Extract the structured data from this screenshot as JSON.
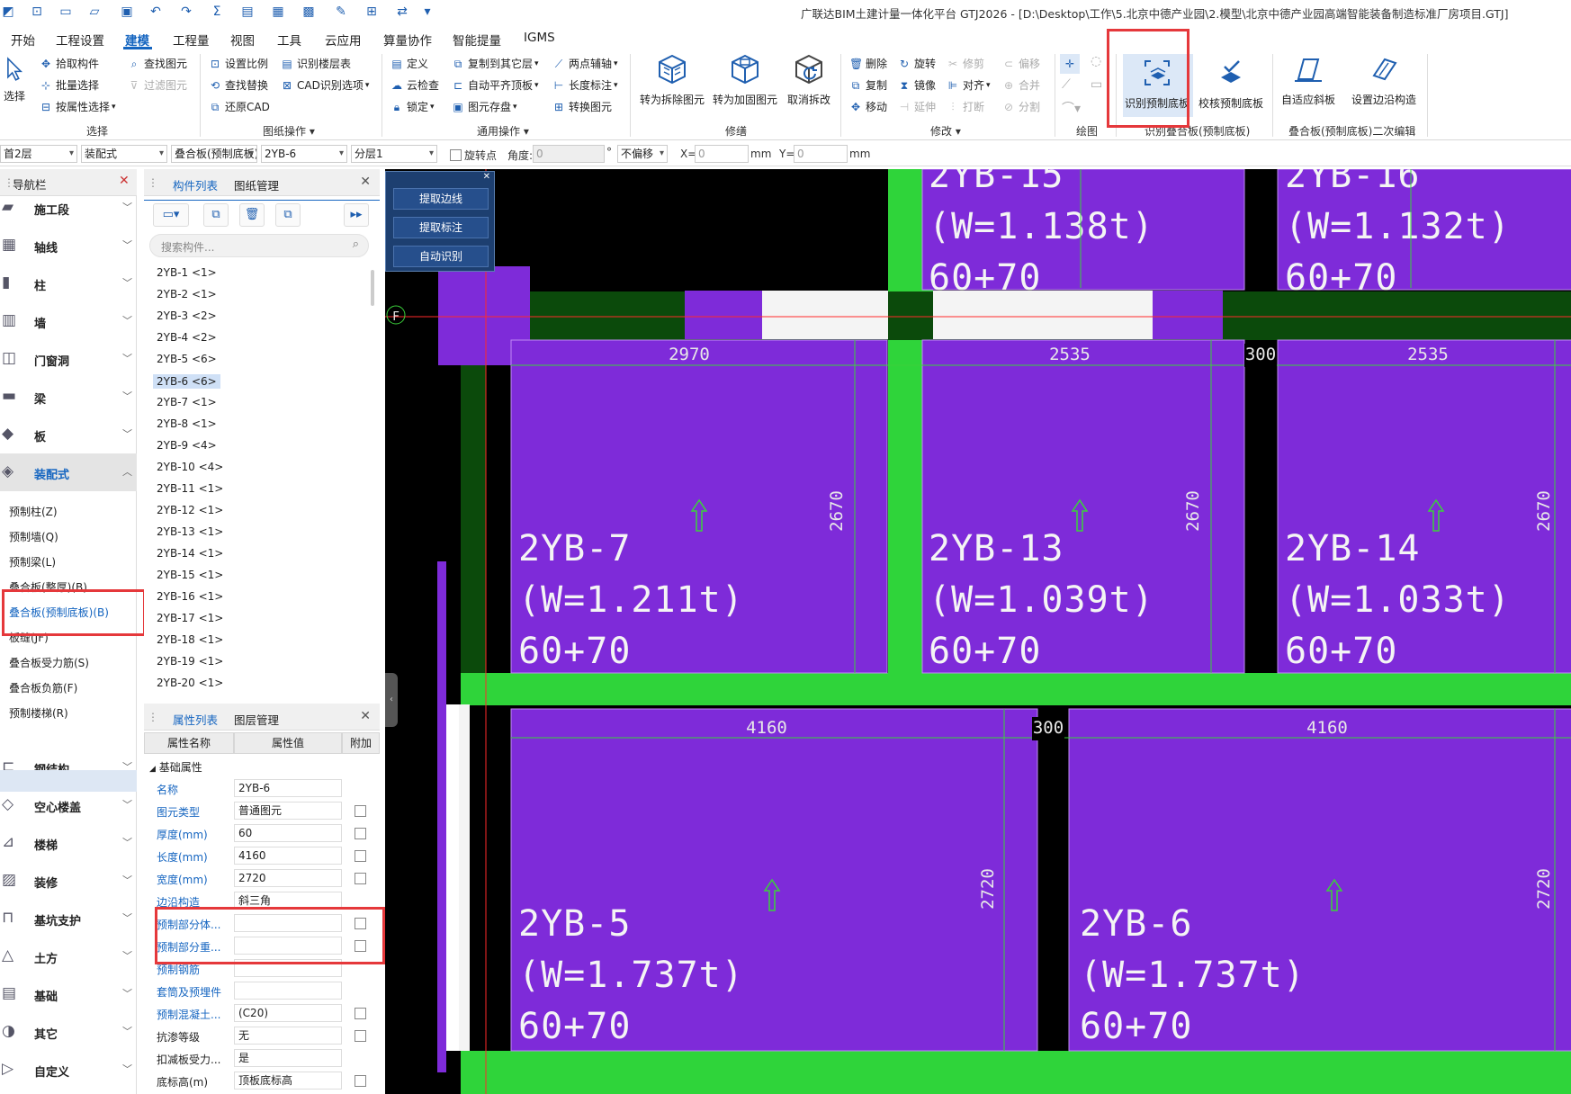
{
  "window": {
    "title": "广联达BIM土建计量一体化平台 GTJ2026 - [D:\\Desktop\\工作\\5.北京中德产业园\\2.模型\\北京中德产业园高端智能装备制造标准厂房项目.GTJ]"
  },
  "menu": {
    "tabs": [
      "开始",
      "工程设置",
      "建模",
      "工程量",
      "视图",
      "工具",
      "云应用",
      "算量协作",
      "智能提量",
      "IGMS"
    ],
    "active": "建模"
  },
  "ribbon": {
    "select_group": {
      "label": "选择",
      "select": "选择",
      "pick": "拾取构件",
      "batch": "批量选择",
      "by_attr": "按属性选择",
      "find": "查找图元",
      "filter": "过滤图元"
    },
    "drawing_group": {
      "label": "图纸操作",
      "set_scale": "设置比例",
      "find_replace": "查找替换",
      "restore_cad": "还原CAD",
      "identify_floor": "识别楼层表",
      "cad_options": "CAD识别选项"
    },
    "general_group": {
      "label": "通用操作",
      "define": "定义",
      "cloud_check": "云检查",
      "lock": "锁定",
      "copy_to_other": "复制到其它层",
      "auto_flat": "自动平齐顶板",
      "save_elem": "图元存盘",
      "two_point_aux": "两点辅轴",
      "length_dim": "长度标注",
      "convert_elem": "转换图元"
    },
    "repair_group": {
      "label": "修缮",
      "to_demolish": "转为拆除图元",
      "to_reinforce": "转为加固图元",
      "cancel_demolish": "取消拆改"
    },
    "modify_group": {
      "label": "修改",
      "delete": "删除",
      "rotate": "旋转",
      "trim": "修剪",
      "offset": "偏移",
      "copy": "复制",
      "mirror": "镜像",
      "align": "对齐",
      "merge": "合并",
      "move": "移动",
      "extend": "延伸",
      "break": "打断",
      "split": "分割"
    },
    "draw_group": {
      "label": "绘图"
    },
    "identify_group": {
      "label": "识别叠合板(预制底板)",
      "identify_bottom": "识别预制底板",
      "check_bottom": "校核预制底板"
    },
    "secondary_group": {
      "label": "叠合板(预制底板)二次编辑",
      "adaptive_slope": "自适应斜板",
      "set_edge": "设置边沿构造"
    }
  },
  "option_bar": {
    "floor": "首2层",
    "category": "装配式",
    "type": "叠合板(预制底板)",
    "component": "2YB-6",
    "sublayer": "分层1",
    "rotate_point": "旋转点",
    "angle_label": "角度:",
    "angle_value": "0",
    "degree": "°",
    "offset_mode": "不偏移",
    "x_label": "X=",
    "x_value": "0",
    "y_label": "Y=",
    "y_value": "0",
    "unit": "mm"
  },
  "nav": {
    "title": "导航栏",
    "categories": [
      "施工段",
      "轴线",
      "柱",
      "墙",
      "门窗洞",
      "梁",
      "板",
      "装配式",
      "钢结构",
      "空心楼盖",
      "楼梯",
      "装修",
      "基坑支护",
      "土方",
      "基础",
      "其它",
      "自定义"
    ],
    "expanded": "装配式",
    "sub_items": [
      "预制柱(Z)",
      "预制墙(Q)",
      "预制梁(L)",
      "叠合板(整厚)(B)",
      "叠合板(预制底板)(B)",
      "板缝(JF)",
      "叠合板受力筋(S)",
      "叠合板负筋(F)",
      "预制楼梯(R)"
    ],
    "active_sub": "叠合板(预制底板)(B)"
  },
  "component_list": {
    "tabs": [
      "构件列表",
      "图纸管理"
    ],
    "search_placeholder": "搜索构件...",
    "items": [
      "2YB-1 <1>",
      "2YB-2 <1>",
      "2YB-3 <2>",
      "2YB-4 <2>",
      "2YB-5 <6>",
      "2YB-6 <6>",
      "2YB-7 <1>",
      "2YB-8 <1>",
      "2YB-9 <4>",
      "2YB-10 <4>",
      "2YB-11 <1>",
      "2YB-12 <1>",
      "2YB-13 <1>",
      "2YB-14 <1>",
      "2YB-15 <1>",
      "2YB-16 <1>",
      "2YB-17 <1>",
      "2YB-18 <1>",
      "2YB-19 <1>",
      "2YB-20 <1>"
    ],
    "selected": "2YB-6 <6>"
  },
  "properties": {
    "tabs": [
      "属性列表",
      "图层管理"
    ],
    "headers": [
      "属性名称",
      "属性值",
      "附加"
    ],
    "group": "基础属性",
    "rows": [
      {
        "name": "名称",
        "value": "2YB-6"
      },
      {
        "name": "图元类型",
        "value": "普通图元"
      },
      {
        "name": "厚度(mm)",
        "value": "60"
      },
      {
        "name": "长度(mm)",
        "value": "4160"
      },
      {
        "name": "宽度(mm)",
        "value": "2720"
      },
      {
        "name": "边沿构造",
        "value": "斜三角"
      },
      {
        "name": "预制部分体...",
        "value": ""
      },
      {
        "name": "预制部分重...",
        "value": ""
      },
      {
        "name": "预制钢筋",
        "value": ""
      },
      {
        "name": "套筒及预埋件",
        "value": ""
      },
      {
        "name": "预制混凝土...",
        "value": "(C20)"
      },
      {
        "name": "抗渗等级",
        "value": "无"
      },
      {
        "name": "扣减板受力...",
        "value": "是"
      },
      {
        "name": "底标高(m)",
        "value": "顶板底标高"
      }
    ]
  },
  "cad_toolbar": {
    "buttons": [
      "提取边线",
      "提取标注",
      "自动识别"
    ]
  },
  "canvas": {
    "axis_label": "F",
    "panels": [
      {
        "name": "2YB-15",
        "weight": "(W=1.138t)",
        "thick": "60+70"
      },
      {
        "name": "2YB-16",
        "weight": "(W=1.132t)",
        "thick": "60+70"
      },
      {
        "name": "2YB-7",
        "weight": "(W=1.211t)",
        "thick": "60+70"
      },
      {
        "name": "2YB-13",
        "weight": "(W=1.039t)",
        "thick": "60+70"
      },
      {
        "name": "2YB-14",
        "weight": "(W=1.033t)",
        "thick": "60+70"
      },
      {
        "name": "2YB-5",
        "weight": "(W=1.737t)",
        "thick": "60+70"
      },
      {
        "name": "2YB-6",
        "weight": "(W=1.737t)",
        "thick": "60+70"
      }
    ],
    "dims_top": [
      "2970",
      "2535",
      "300",
      "2535"
    ],
    "dims_vertical_top": [
      "2670",
      "2670",
      "2670"
    ],
    "dims_bottom": [
      "4160",
      "300",
      "4160"
    ],
    "dims_vertical_bottom": [
      "2720",
      "2720"
    ],
    "colors": {
      "slab": "#7e2bd9",
      "beam": "#2fd43a",
      "dark_beam": "#0b4a0b",
      "gap": "#000000",
      "white": "#f4f4f4",
      "dim_line": "#3bd13b",
      "axis_line": "#ff2a2a"
    }
  }
}
